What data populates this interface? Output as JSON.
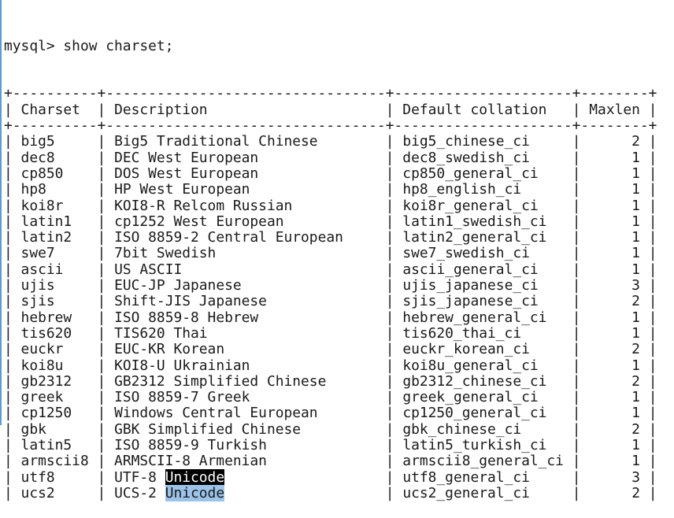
{
  "terminal": {
    "prompt": "mysql> ",
    "command": "show charset;",
    "colors": {
      "background": "#ffffff",
      "text": "#1a1a1a",
      "selection": "#000000"
    },
    "columns": [
      "Charset",
      "Description",
      "Default collation",
      "Maxlen"
    ],
    "rows": [
      [
        "big5",
        "Big5 Traditional Chinese",
        "big5_chinese_ci",
        "2"
      ],
      [
        "dec8",
        "DEC West European",
        "dec8_swedish_ci",
        "1"
      ],
      [
        "cp850",
        "DOS West European",
        "cp850_general_ci",
        "1"
      ],
      [
        "hp8",
        "HP West European",
        "hp8_english_ci",
        "1"
      ],
      [
        "koi8r",
        "KOI8-R Relcom Russian",
        "koi8r_general_ci",
        "1"
      ],
      [
        "latin1",
        "cp1252 West European",
        "latin1_swedish_ci",
        "1"
      ],
      [
        "latin2",
        "ISO 8859-2 Central European",
        "latin2_general_ci",
        "1"
      ],
      [
        "swe7",
        "7bit Swedish",
        "swe7_swedish_ci",
        "1"
      ],
      [
        "ascii",
        "US ASCII",
        "ascii_general_ci",
        "1"
      ],
      [
        "ujis",
        "EUC-JP Japanese",
        "ujis_japanese_ci",
        "3"
      ],
      [
        "sjis",
        "Shift-JIS Japanese",
        "sjis_japanese_ci",
        "2"
      ],
      [
        "hebrew",
        "ISO 8859-8 Hebrew",
        "hebrew_general_ci",
        "1"
      ],
      [
        "tis620",
        "TIS620 Thai",
        "tis620_thai_ci",
        "1"
      ],
      [
        "euckr",
        "EUC-KR Korean",
        "euckr_korean_ci",
        "2"
      ],
      [
        "koi8u",
        "KOI8-U Ukrainian",
        "koi8u_general_ci",
        "1"
      ],
      [
        "gb2312",
        "GB2312 Simplified Chinese",
        "gb2312_chinese_ci",
        "2"
      ],
      [
        "greek",
        "ISO 8859-7 Greek",
        "greek_general_ci",
        "1"
      ],
      [
        "cp1250",
        "Windows Central European",
        "cp1250_general_ci",
        "1"
      ],
      [
        "gbk",
        "GBK Simplified Chinese",
        "gbk_chinese_ci",
        "2"
      ],
      [
        "latin5",
        "ISO 8859-9 Turkish",
        "latin5_turkish_ci",
        "1"
      ],
      [
        "armscii8",
        "ARMSCII-8 Armenian",
        "armscii8_general_ci",
        "1"
      ],
      [
        "utf8",
        "UTF-8 Unicode",
        "utf8_general_ci",
        "3"
      ],
      [
        "ucs2",
        "UCS-2 Unicode",
        "ucs2_general_ci",
        "2"
      ]
    ],
    "selected_word": "Unicode"
  }
}
